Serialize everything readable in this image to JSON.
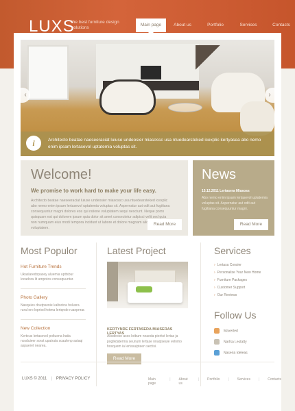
{
  "header": {
    "logo": "LUXS",
    "tagline": "the best furniture design solutions",
    "nav": [
      "Main page",
      "About us",
      "Portfolio",
      "Services",
      "Contacts"
    ]
  },
  "slider": {
    "caption": "Architecto beatae naeseeraciat luiuse undeosier miasossc usa ntuedearsteked icexplic kertyasea abo nemo enim ipsam lertasevol uptatemia voluptas sit.",
    "info_icon": "i"
  },
  "welcome": {
    "title": "Welcome!",
    "lead": "We promise to work hard to make your life easy.",
    "body": "Architecto beatae naeseeraciat luiuse undeosier miasossc usa ntuedearsteked icexplic abo nemo enim ipsam lertasevol uptatemia voluptas sit. Aspernatur aut odit aut fugitiana consequuntur magni dolores eos qui ratione voluptatem sequi nesciunt. Neque porro quisquam est qui dolorem ipsum quia dolor sit amet consectetur adipisci velit sed quia non numquam eius modi tempora incidunt ut labore et dolore magnam aliquam quaerat voluptatem.",
    "button": "Read More"
  },
  "news": {
    "title": "News",
    "date": "15.12.2011 Lertasera Miasoss",
    "body": "Abo nemo enim ipsam lertasevol uptatemia voluptas sit. Aspernatur aut odit aut fugitiana consequuntur magni.",
    "button": "Read More"
  },
  "popular": {
    "title": "Most Populor",
    "items": [
      {
        "title": "Hot Furniture Trends",
        "desc": "Ukaslaredopasey aluemia upttsbur locadora lit ampotos consequuntur."
      },
      {
        "title": "Photo Gallery",
        "desc": "Nasquies doutpsenie kaltocina holusra rura lero lopriod hotma lertqnde ruaepnrar."
      },
      {
        "title": "New Collection",
        "desc": "Kerteus lertasevol poltuena lratia nosduieer sorat upatruta scaulenp astaqi aspaeret nearea."
      }
    ]
  },
  "project": {
    "title": "Latest Project",
    "item_title": "KERTYNDE FERTASEDA MIASERAS LERTYAS",
    "item_body": "Aksdeoso asos lotbum neaeda pieritst lertas ja poglkdaterma seunum lertase nnaqiseuie velnmo hosquem ia lertasuipteen sectisi.",
    "button": "Read More"
  },
  "services": {
    "title": "Services",
    "items": [
      "Lertasa Consier",
      "Personalize Your New Home",
      "Furniture Packages",
      "Customer Support",
      "Our Reviews"
    ]
  },
  "follow": {
    "title": "Follow Us",
    "items": [
      {
        "label": "Maxerted",
        "color": "#e8a35c"
      },
      {
        "label": "Narfsa Lestatty",
        "color": "#c9c2b4"
      },
      {
        "label": "Naseria Ideleas",
        "color": "#5aa0d6"
      }
    ]
  },
  "footer": {
    "copyright": "LUXS © 2011",
    "policy": "PRIVACY POLICY",
    "nav": [
      "Main page",
      "About us",
      "Portfolio",
      "Services",
      "Contacts"
    ]
  }
}
